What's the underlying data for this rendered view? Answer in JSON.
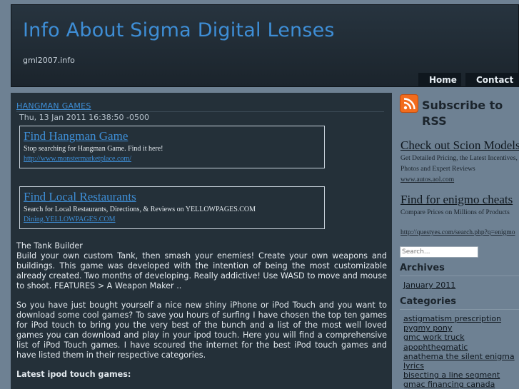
{
  "header": {
    "title": "Info About Sigma Digital Lenses",
    "tagline": "gml2007.info"
  },
  "nav": {
    "home": "Home",
    "contact": "Contact"
  },
  "post": {
    "title": "Hangman Games",
    "date": "Thu, 13 Jan 2011 16:38:50 -0500",
    "ads": [
      {
        "title": "Find Hangman Game",
        "desc": "Stop searching for Hangman Game. Find it here!",
        "url": "http://www.monstermarketplace.com/"
      },
      {
        "title": "Find Local Restaurants",
        "desc": "Search for Local Restaurants, Directions, & Reviews on YELLOWPAGES.COM",
        "url": "Dining.YELLOWPAGES.COM"
      }
    ],
    "paragraphs": [
      "The Tank Builder",
      "Build your own custom Tank, then smash your enemies! Create your own weapons and buildings. This game was developed with the intention of being the most customizable already created. Two months of developing. Really addictive! Use WASD to move and mouse to shoot. FEATURES > A Weapon Maker ..",
      "So you have just bought yourself a nice new shiny iPhone or iPod Touch and you want to download some cool games? To save you hours of surfing I have chosen the top ten games for iPod touch to bring you the very best of the bunch and a list of the most well loved games you can download and play in your ipod touch. Here you will find a comprehensive list of iPod Touch games. I have scoured the internet for the best iPod touch games and have listed them in their respective categories."
    ],
    "latest_heading": "Latest ipod touch games:"
  },
  "sidebar": {
    "rss": "Subscribe to RSS",
    "ads": [
      {
        "title": "Check out Scion Models",
        "desc": "Get Detailed Pricing, the Latest Incentives, Photos and Expert Reviews",
        "url": "www.autos.aol.com"
      },
      {
        "title": "Find for enigmo cheats",
        "desc": "Compare Prices on Millions of Products",
        "url": "http://questyes.com/search.php?q=enigmo"
      }
    ],
    "search_placeholder": "Search...",
    "archives_heading": "Archives",
    "archives": [
      "January 2011"
    ],
    "categories_heading": "Categories",
    "categories": [
      "astigmatism prescription",
      "pygmy pony",
      "gmc work truck",
      "apophthegmatic",
      "anathema the silent enigma lyrics",
      "bisecting a line segment",
      "gmac financing canada"
    ]
  },
  "colors": {
    "background": "#6e8193",
    "header": "#1b242c",
    "main": "#243039",
    "link": "#3e8ed6",
    "rss": "#f26c1d"
  }
}
